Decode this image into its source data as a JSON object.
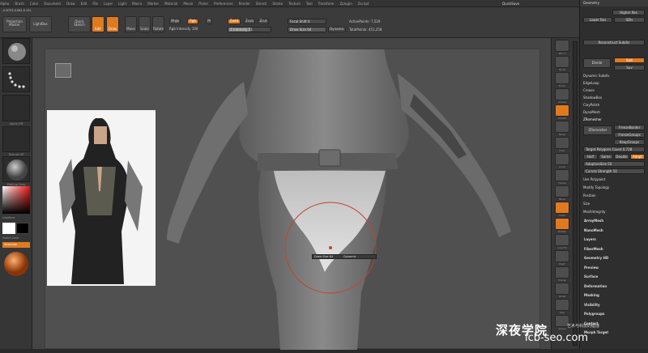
{
  "menubar": {
    "items": [
      "Alpha",
      "Brush",
      "Color",
      "Document",
      "Draw",
      "Edit",
      "File",
      "Layer",
      "Light",
      "Macro",
      "Marker",
      "Material",
      "Movie",
      "Picker",
      "Preferences",
      "Render",
      "Stencil",
      "Stroke",
      "Texture",
      "Tool",
      "Transform",
      "Zplugin",
      "Zscript"
    ],
    "right_label": "QuickSave"
  },
  "toolbar": {
    "projection_master": "Projection Master",
    "lightbox": "LightBox",
    "quick_sketch": "Quick Sketch",
    "edit": "Edit",
    "draw": "Draw",
    "move": "Move",
    "scale": "Scale",
    "rotate": "Rotate",
    "mrgb": "Mrgb",
    "rgb": "Rgb",
    "m": "M",
    "rgb_intensity_label": "Rgb Intensity",
    "rgb_intensity_value": "100",
    "zadd": "Zadd",
    "zsub": "Zsub",
    "zcut": "Zcut",
    "z_intensity_label": "Z Intensity",
    "z_intensity_value": "51",
    "z_intensity_level": 0.51,
    "focal_shift_label": "Focal Shift",
    "focal_shift_value": "0",
    "draw_size_label": "Draw Size",
    "draw_size_value": "64",
    "dynamic": "Dynamic",
    "active_points": "ActivePoints: 7,529",
    "total_points": "TotalPoints: 451,258",
    "coords": "-0.6733,0.081,0.151"
  },
  "leftshelf": {
    "alpha_caption": "Alpha Off",
    "texture_caption": "Texture Off",
    "material_caption": "MatCap Gray",
    "gradient": "Gradient",
    "switch_color": "SwitchColor",
    "alternate": "Alternate"
  },
  "rightshelf": {
    "items": [
      "SPix 3",
      "Scroll",
      "Zoom",
      "Actual",
      "AAHalf",
      "Persp",
      "Floor",
      "Local",
      "Frame",
      "Move",
      "Scale",
      "Rotate",
      "Line Fill",
      "PolyF",
      "Transp",
      "Ghost",
      "Solo",
      "Xpose"
    ]
  },
  "panel": {
    "header": "Geometry",
    "higher_res": "Higher Res",
    "lower_res": "Lower Res",
    "sdiv": "SDiv",
    "reconstruct_subdiv": "Reconstruct Subdiv",
    "divide": "Divide",
    "smt": "Smt",
    "suv": "Suv",
    "dynamic_subdiv": "Dynamic Subdiv",
    "edge_loop": "EdgeLoop",
    "crease": "Crease",
    "shadow_box": "ShadowBox",
    "clay_polish": "ClayPolish",
    "dyna_mesh": "DynaMesh",
    "zremesher": "ZRemesher",
    "zremesher_btn": "ZRemesher",
    "freeze_border": "FreezeBorder",
    "freeze_groups": "FreezeGroups",
    "keep_groups": "KeepGroups",
    "target_polygons": "Target Polygons Count 0.728",
    "half": "Half",
    "same": "Same",
    "double": "Double",
    "adapt": "Adapt",
    "adaptive_size": "AdaptiveSize 50",
    "curves_strength": "Curves Strength 50",
    "use_polypaint": "Use Polypaint",
    "modify_topology": "Modify Topology",
    "position": "Position",
    "size": "Size",
    "mesh_integrity": "MeshIntegrity",
    "menus": [
      "ArrayMesh",
      "NanoMesh",
      "Layers",
      "FiberMesh",
      "Geometry HD",
      "Preview",
      "Surface",
      "Deformation",
      "Masking",
      "Visibility",
      "Polygroups",
      "Contact",
      "Morph Target"
    ]
  },
  "brush_popup": {
    "label": "Draw Size",
    "value": "64",
    "dynamic": "Dynamic"
  },
  "watermark": {
    "text": "深夜学院",
    "subtitle": "艺术与科技的碰撞",
    "site": "lcb-seo.com"
  },
  "colors": {
    "accent": "#e07a1f",
    "bg": "#2a2a2a"
  }
}
